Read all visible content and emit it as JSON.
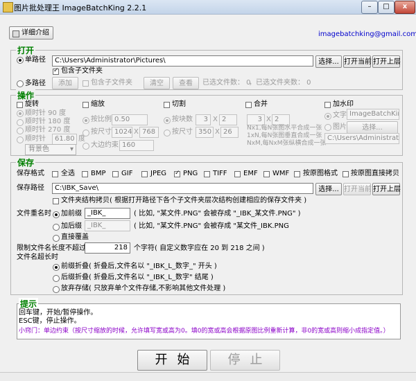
{
  "window": {
    "title": "图片批处理王 ImageBatchKing 2.2.1",
    "minimize_glyph": "–",
    "maximize_glyph": "□",
    "close_glyph": "x"
  },
  "top": {
    "detail_button": "详细介绍",
    "email": "imagebatchking@gmail.com"
  },
  "open": {
    "legend": "打开",
    "single_path_label": "单路径",
    "single_path_value": "C:\\Users\\Administrator\\Pictures\\",
    "browse": "选择...",
    "open_current": "打开当前",
    "open_parent": "打开上层",
    "include_sub": "包含子文件夹",
    "multi_path_label": "多路径",
    "add": "添加",
    "include_sub2": "包含子文件夹",
    "clear": "清空",
    "view": "查看",
    "selected_files": "已选文件数： 0",
    "selected_folders": "，已选文件夹数： 0"
  },
  "ops": {
    "legend": "操作",
    "rotate": {
      "label": "旋转",
      "options": [
        "顺时针 90 度",
        "顺时针 180 度",
        "顺时针 270 度",
        "顺时针"
      ],
      "custom_value": "61.80",
      "custom_unit": "度",
      "bg_select": "背景色"
    },
    "scale": {
      "label": "缩放",
      "by_ratio": "按比例",
      "ratio_value": "0.50",
      "by_size": "按尺寸",
      "w": "1024",
      "x1": "X",
      "h": "768",
      "by_edge": "大边约束",
      "edge_value": "160"
    },
    "cut": {
      "label": "切割",
      "by_blocks": "按块数",
      "bx": "3",
      "x1": "X",
      "by": "2",
      "by_size": "按尺寸",
      "sw": "350",
      "x2": "X",
      "sh": "26"
    },
    "merge": {
      "label": "合并",
      "mx": "3",
      "x1": "X",
      "my": "2",
      "hint1": "Nx1,每N张图水平合成一张",
      "hint2": "1xN,每N张图垂直合成一张",
      "hint3": "NxM,每NxM张纵横合成一张"
    },
    "watermark": {
      "label": "加水印",
      "text_label": "文字",
      "text_value": "ImageBatchKing",
      "image_label": "图片",
      "choose": "选择...",
      "path": "C:\\Users\\Administrator\\Pi"
    }
  },
  "save": {
    "legend": "保存",
    "format_label": "保存格式",
    "formats": [
      "全选",
      "BMP",
      "GIF",
      "JPEG",
      "PNG",
      "TIFF",
      "EMF",
      "WMF",
      "按原图格式",
      "按原图直接拷贝"
    ],
    "path_label": "保存路径",
    "path_value": "C:\\IBK_Save\\",
    "browse": "选择...",
    "open_current": "打开当前",
    "open_parent": "打开上层",
    "structure_copy": "文件夹结构拷贝( 根据打开路径下各个子文件夹层次结构创建相应的保存文件夹 )",
    "rename_label": "文件重名时",
    "prefix_label": "加前缀",
    "prefix_value": "_IBK_",
    "prefix_note": "( 比如, \"某文件.PNG\" 会被存成 \"_IBK_某文件.PNG\" )",
    "suffix_label": "加后缀",
    "suffix_value": "_IBK_",
    "suffix_note": "( 比如, \"某文件.PNG\" 会被存成 \"某文件_IBK.PNG",
    "overwrite_label": "直接覆盖",
    "maxlen_label": "限制文件名长度不超过",
    "maxlen_value": "218",
    "maxlen_note": "个字符( 自定义数字应在 20 到 218 之间 )",
    "overlen_label": "文件名超长时",
    "fold_front": "前缀折叠( 折叠后,文件名以 \"_IBK_L_数字_\" 开头 )",
    "fold_back": "后缀折叠( 折叠后,文件名以 \"_IBK_L_数字\" 结尾 )",
    "give_up": "放弃存储( 只放弃单个文件存储,不影响其他文件处理 )"
  },
  "hint": {
    "legend": "提示",
    "line1": "回车键，开始/暂停操作。",
    "line2": "ESC键，停止操作。",
    "tip": "小窍门：单边约束（按尺寸缩放的时候，允许填写宽或高为0。填0的宽或高会根据原图比例重新计算，非0的宽或高则缩小成指定值。）"
  },
  "actions": {
    "start": "开始",
    "stop": "停止"
  },
  "colors": {
    "legend_green": "#008000",
    "tip_purple": "#8b00c8",
    "email_blue": "#0000cc"
  }
}
